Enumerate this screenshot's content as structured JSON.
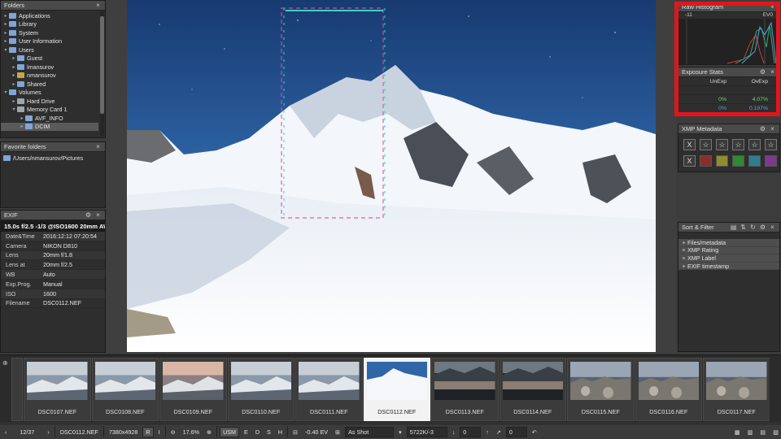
{
  "folders_panel": {
    "title": "Folders",
    "items": [
      {
        "label": "Applications",
        "depth": 0,
        "toggle": "▸",
        "icon": "folder"
      },
      {
        "label": "Library",
        "depth": 0,
        "toggle": "▸",
        "icon": "folder"
      },
      {
        "label": "System",
        "depth": 0,
        "toggle": "▸",
        "icon": "folder"
      },
      {
        "label": "User Information",
        "depth": 0,
        "toggle": "▸",
        "icon": "folder"
      },
      {
        "label": "Users",
        "depth": 0,
        "toggle": "▾",
        "icon": "folder"
      },
      {
        "label": "Guest",
        "depth": 1,
        "toggle": "▸",
        "icon": "folder"
      },
      {
        "label": "lmansurov",
        "depth": 1,
        "toggle": "▸",
        "icon": "folder"
      },
      {
        "label": "nmansurov",
        "depth": 1,
        "toggle": "▸",
        "icon": "home"
      },
      {
        "label": "Shared",
        "depth": 1,
        "toggle": "▸",
        "icon": "folder"
      },
      {
        "label": "Volumes",
        "depth": 0,
        "toggle": "▾",
        "icon": "folder"
      },
      {
        "label": "Hard Drive",
        "depth": 1,
        "toggle": "▸",
        "icon": "drive"
      },
      {
        "label": "Memory Card 1",
        "depth": 1,
        "toggle": "▾",
        "icon": "drive"
      },
      {
        "label": "AVF_INFO",
        "depth": 2,
        "toggle": "▸",
        "icon": "folder"
      },
      {
        "label": "DCIM",
        "depth": 2,
        "toggle": "▸",
        "icon": "folder",
        "selected": true
      }
    ]
  },
  "favorites_panel": {
    "title": "Favorite folders",
    "items": [
      "/Users/nmansurov/Pictures"
    ]
  },
  "exif_panel": {
    "title": "EXIF",
    "summary": "15.0s f/2.5 -1/3 @ISO1600 20mm AW",
    "rows": [
      {
        "key": "Date&Time",
        "value": "2016:12:12 07:20:54"
      },
      {
        "key": "Camera",
        "value": "NIKON D810"
      },
      {
        "key": "Lens",
        "value": "20mm f/1.8"
      },
      {
        "key": "Lens at",
        "value": "20mm f/2.5"
      },
      {
        "key": "WB",
        "value": "Auto"
      },
      {
        "key": "Exp.Prog.",
        "value": "Manual"
      },
      {
        "key": "ISO",
        "value": "1600"
      },
      {
        "key": "Filename",
        "value": "DSC0112.NEF"
      }
    ]
  },
  "histogram_panel": {
    "title": "Raw Histogram",
    "left_label": "-11",
    "right_label": "EV0",
    "highlight_color": "#e4141b"
  },
  "exposure_stats": {
    "title": "Exposure Stats",
    "headers": [
      "UnExp",
      "OvExp"
    ],
    "rows": [
      {
        "values": [
          "",
          ""
        ]
      },
      {
        "values": [
          "0%",
          "4.07%"
        ],
        "color": "#6fd46a"
      },
      {
        "values": [
          "0%",
          "0.197%"
        ],
        "color": "#5a9ee8"
      }
    ]
  },
  "xmp_panel": {
    "title": "XMP Metadata",
    "reject_label": "X",
    "star_glyph": "☆",
    "star_count": 5,
    "colors": [
      "#8a2f2a",
      "#8f8c2a",
      "#2e8a2e",
      "#2d7f8c",
      "#7d3a8c"
    ]
  },
  "sort_filter_panel": {
    "title": "Sort & Filter",
    "items": [
      "Files/metadata",
      "XMP Rating",
      "XMP Label",
      "EXIF timestamp"
    ]
  },
  "filmstrip": {
    "items": [
      {
        "label": "DSC0107.NEF",
        "scene": "glacier"
      },
      {
        "label": "DSC0108.NEF",
        "scene": "glacier"
      },
      {
        "label": "DSC0109.NEF",
        "scene": "glacier-sunset"
      },
      {
        "label": "DSC0110.NEF",
        "scene": "glacier"
      },
      {
        "label": "DSC0111.NEF",
        "scene": "glacier"
      },
      {
        "label": "DSC0112.NEF",
        "scene": "snow",
        "selected": true
      },
      {
        "label": "DSC0113.NEF",
        "scene": "lake"
      },
      {
        "label": "DSC0114.NEF",
        "scene": "lake"
      },
      {
        "label": "DSC0115.NEF",
        "scene": "rocks"
      },
      {
        "label": "DSC0116.NEF",
        "scene": "rocks"
      },
      {
        "label": "DSC0117.NEF",
        "scene": "rocks"
      }
    ]
  },
  "status_bar": {
    "counter": "12/37",
    "filename": "DSC0112.NEF",
    "dimensions": "7380x4928",
    "r_label": "R",
    "i_label": "I",
    "zoom": "17.6%",
    "usm": "USM",
    "e_label": "E",
    "d_label": "D",
    "s_label": "S",
    "h_label": "H",
    "ev": "-0.40 EV",
    "wb": "As Shot",
    "temp": "5722K/-3",
    "rotation": "0",
    "straighten": "0"
  }
}
